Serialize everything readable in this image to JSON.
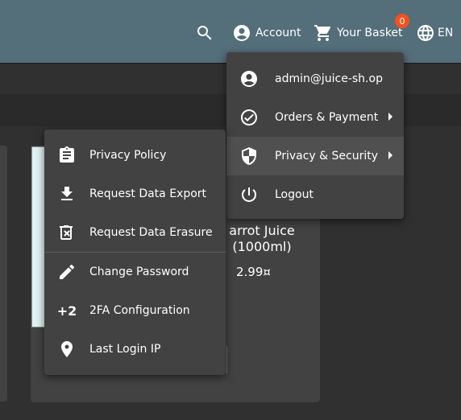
{
  "header": {
    "account_label": "Account",
    "basket_label": "Your Basket",
    "basket_count": "0",
    "language_label": "EN"
  },
  "account_menu": {
    "items": [
      {
        "label": "admin@juice-sh.op",
        "icon": "account-circle-icon"
      },
      {
        "label": "Orders & Payment",
        "icon": "check-circle-icon"
      },
      {
        "label": "Privacy & Security",
        "icon": "shield-icon"
      },
      {
        "label": "Logout",
        "icon": "power-icon"
      }
    ]
  },
  "privacy_menu": {
    "items": [
      {
        "label": "Privacy Policy",
        "icon": "clipboard-icon"
      },
      {
        "label": "Request Data Export",
        "icon": "download-icon"
      },
      {
        "label": "Request Data Erasure",
        "icon": "trash-icon"
      },
      {
        "label": "Change Password",
        "icon": "pencil-icon"
      },
      {
        "label": "2FA Configuration",
        "icon": "plus-two-icon",
        "icon_text": "+2"
      },
      {
        "label": "Last Login IP",
        "icon": "location-pin-icon"
      }
    ]
  },
  "product": {
    "name": "arrot Juice (1000ml)",
    "price": "2.99¤"
  },
  "colors": {
    "toolbar": "#546e7a",
    "menu": "#424242",
    "badge": "#f4511e"
  }
}
